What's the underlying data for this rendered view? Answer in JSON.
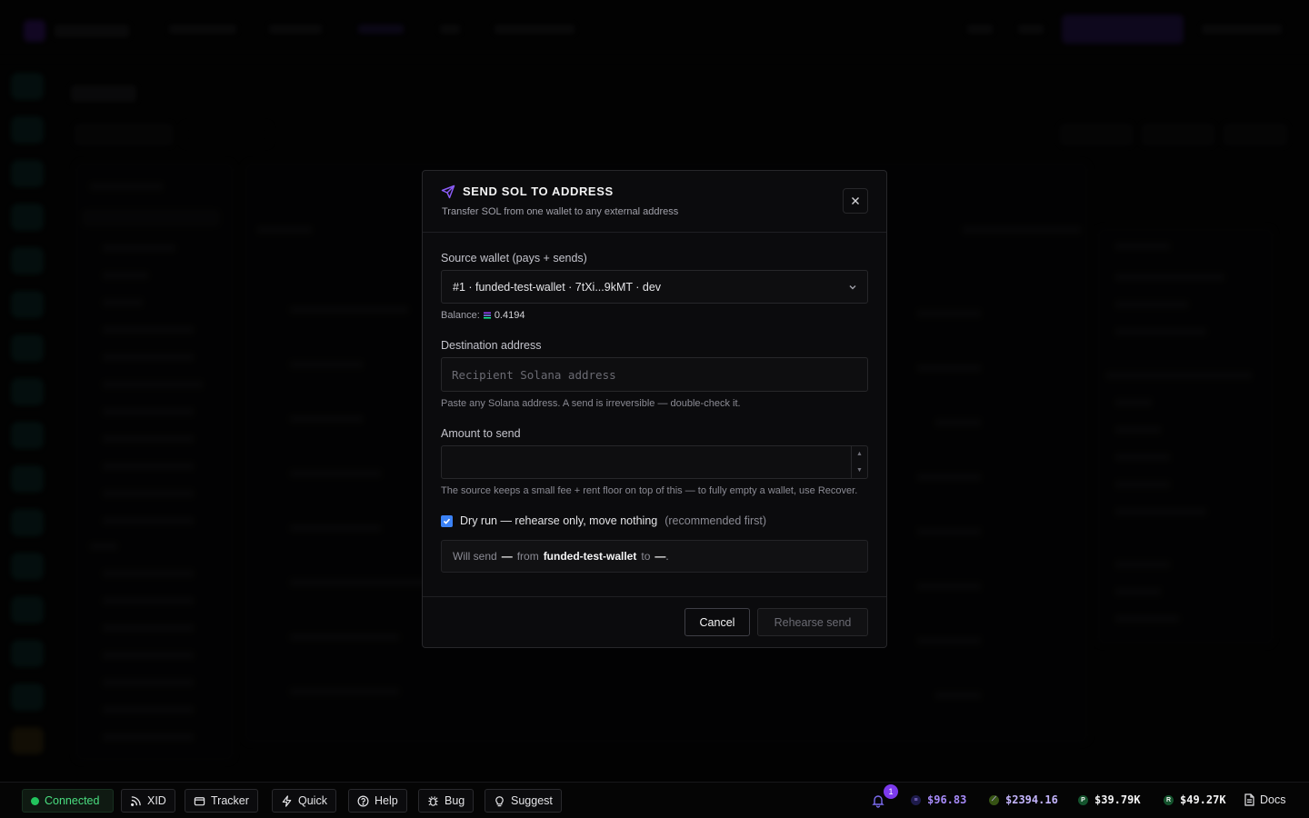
{
  "modal": {
    "title": "SEND SOL TO ADDRESS",
    "subtitle": "Transfer SOL from one wallet to any external address",
    "close_label": "×",
    "source": {
      "label": "Source wallet (pays + sends)",
      "selected": "#1 · funded-test-wallet · 7tXi...9kMT · dev",
      "balance_label": "Balance:",
      "balance_value": "0.4194"
    },
    "destination": {
      "label": "Destination address",
      "value": "",
      "placeholder": "Recipient Solana address",
      "hint": "Paste any Solana address. A send is irreversible — double-check it."
    },
    "amount": {
      "label": "Amount to send",
      "value": "",
      "hint": "The source keeps a small fee + rent floor on top of this — to fully empty a wallet, use Recover."
    },
    "dry_run": {
      "checked": true,
      "label": "Dry run — rehearse only, move nothing",
      "note": "(recommended first)"
    },
    "summary": {
      "prefix": "Will send",
      "amount": "—",
      "from_word": "from",
      "wallet": "funded-test-wallet",
      "to_word": "to",
      "destination": "—",
      "suffix": "."
    },
    "cancel_label": "Cancel",
    "submit_label": "Rehearse send"
  },
  "statusbar": {
    "connected": "Connected",
    "buttons": {
      "xid": "XID",
      "tracker": "Tracker",
      "quick": "Quick",
      "help": "Help",
      "bug": "Bug",
      "suggest": "Suggest"
    },
    "notifications": "1",
    "tickers": [
      {
        "symbol": "≡",
        "value": "$96.83",
        "color": "#a78bfa",
        "icon_bg": "#1e1b4b"
      },
      {
        "symbol": "⟋",
        "value": "$2394.16",
        "color": "#c4b5fd",
        "icon_bg": "#365314"
      },
      {
        "symbol": "P",
        "value": "$39.79K",
        "color": "#f4f4f5",
        "icon_bg": "#14532d"
      },
      {
        "symbol": "R",
        "value": "$49.27K",
        "color": "#f4f4f5",
        "icon_bg": "#14532d"
      }
    ],
    "docs": "Docs"
  },
  "colors": {
    "accent": "#7c3aed",
    "connected": "#22c55e",
    "checkbox": "#3b82f6"
  }
}
